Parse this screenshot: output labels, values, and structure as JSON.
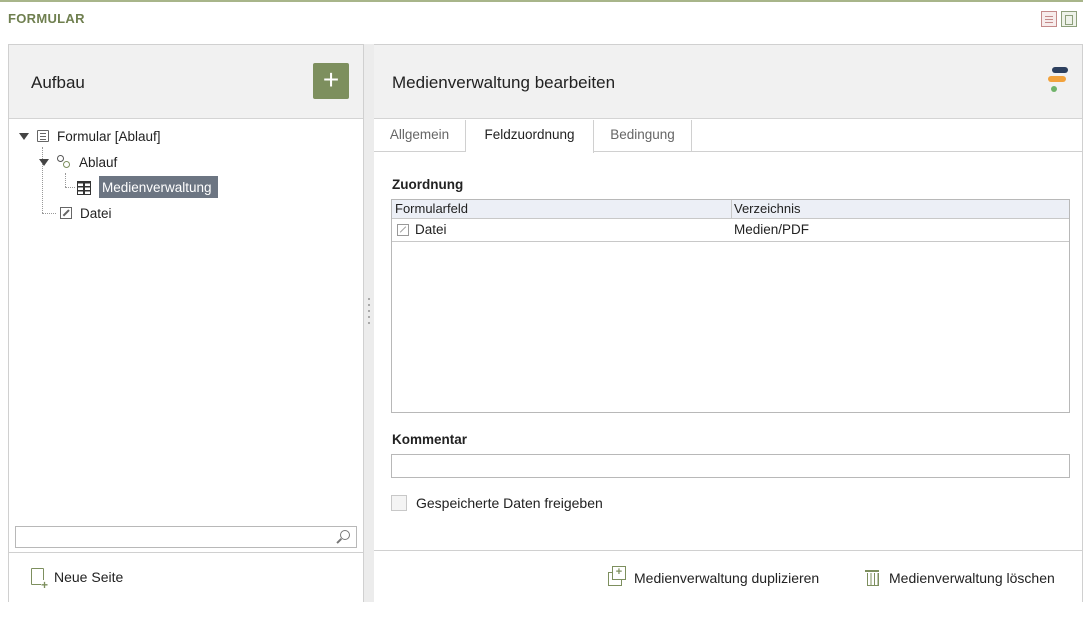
{
  "window": {
    "title": "FORMULAR"
  },
  "left": {
    "header_title": "Aufbau",
    "add_label": "+",
    "tree": [
      {
        "label": "Formular [Ablauf]",
        "icon": "form-icon",
        "expanded": true
      },
      {
        "label": "Ablauf",
        "icon": "flow-icon",
        "expanded": true
      },
      {
        "label": "Medienverwaltung",
        "icon": "media-management-icon",
        "selected": true
      },
      {
        "label": "Datei",
        "icon": "file-field-icon"
      }
    ],
    "search": {
      "value": "",
      "placeholder": ""
    },
    "footer": {
      "new_page_label": "Neue Seite"
    }
  },
  "right": {
    "header_title": "Medienverwaltung bearbeiten",
    "tabs": [
      {
        "label": "Allgemein",
        "active": false
      },
      {
        "label": "Feldzuordnung",
        "active": true
      },
      {
        "label": "Bedingung",
        "active": false
      }
    ],
    "mapping": {
      "title": "Zuordnung",
      "columns": [
        "Formularfeld",
        "Verzeichnis"
      ],
      "rows": [
        {
          "field": "Datei",
          "directory": "Medien/PDF"
        }
      ]
    },
    "comment": {
      "label": "Kommentar",
      "value": ""
    },
    "release_checkbox": {
      "label": "Gespeicherte Daten freigeben",
      "checked": false
    },
    "footer": {
      "duplicate_label": "Medienverwaltung duplizieren",
      "delete_label": "Medienverwaltung löschen"
    }
  },
  "colors": {
    "accent_green": "#7d8f5e",
    "selection": "#6c7582",
    "header_bg": "#f1f1f1",
    "table_header_bg": "#eceff6"
  }
}
